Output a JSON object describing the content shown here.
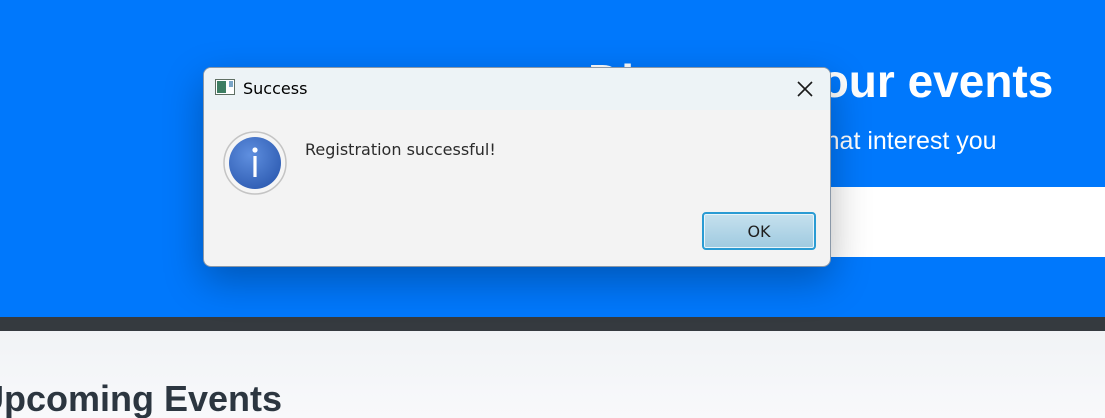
{
  "background_page": {
    "hero": {
      "title": "Discover your events",
      "subtitle": "Find and join events that interest you",
      "search_placeholder": ""
    },
    "section": {
      "title": "Upcoming Events"
    }
  },
  "dialog": {
    "title": "Success",
    "message": "Registration successful!",
    "ok_label": "OK",
    "icons": {
      "app": "java-app-icon",
      "close": "close-icon",
      "message": "info-icon"
    }
  },
  "colors": {
    "hero_background": "#0078fc",
    "divider": "#353a3f",
    "dialog_background": "#f3f3f3",
    "ok_button_border": "#2a9bd3",
    "info_icon": "#3a6cc6"
  }
}
